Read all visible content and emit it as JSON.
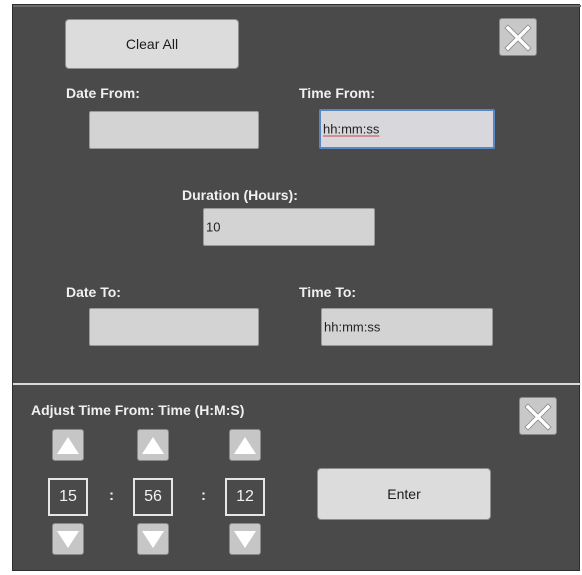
{
  "top": {
    "clear_all_label": "Clear All",
    "date_from_label": "Date From:",
    "time_from_label": "Time From:",
    "date_from_value": "",
    "time_from_value": "hh:mm:ss",
    "duration_label": "Duration (Hours):",
    "duration_value": "10",
    "date_to_label": "Date To:",
    "time_to_label": "Time To:",
    "date_to_value": "",
    "time_to_value": "hh:mm:ss"
  },
  "adjust": {
    "title": "Adjust Time From: Time (H:M:S)",
    "hours": "15",
    "minutes": "56",
    "seconds": "12",
    "separator": ":",
    "enter_label": "Enter"
  },
  "icons": {
    "close": "close-icon",
    "up": "arrow-up-icon",
    "down": "arrow-down-icon"
  },
  "colors": {
    "panel": "#4a4a4a",
    "button": "#dcdcdc",
    "focus_border": "#5a86c6"
  }
}
